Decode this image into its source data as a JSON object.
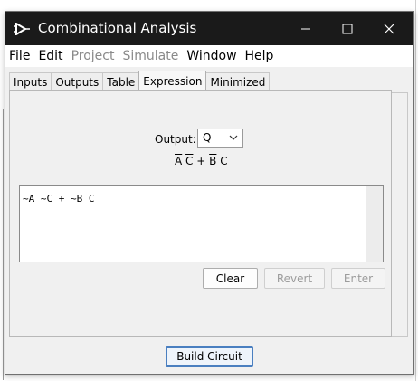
{
  "window": {
    "title": "Combinational Analysis"
  },
  "menu": [
    {
      "label": "File",
      "enabled": true
    },
    {
      "label": "Edit",
      "enabled": true
    },
    {
      "label": "Project",
      "enabled": false
    },
    {
      "label": "Simulate",
      "enabled": false
    },
    {
      "label": "Window",
      "enabled": true
    },
    {
      "label": "Help",
      "enabled": true
    }
  ],
  "tabs": [
    {
      "label": "Inputs",
      "selected": false
    },
    {
      "label": "Outputs",
      "selected": false
    },
    {
      "label": "Table",
      "selected": false
    },
    {
      "label": "Expression",
      "selected": true
    },
    {
      "label": "Minimized",
      "selected": false
    }
  ],
  "expression": {
    "output_label": "Output:",
    "output_value": "Q",
    "rendered": {
      "A": "A",
      "C1": "C",
      "plus": "+",
      "B": "B",
      "C2": "C"
    },
    "text": "~A ~C + ~B C",
    "buttons": {
      "clear": "Clear",
      "revert": "Revert",
      "enter": "Enter"
    }
  },
  "footer": {
    "build_circuit": "Build Circuit"
  },
  "icons": {
    "app": "logisim-gate-icon",
    "minimize": "minimize-icon",
    "maximize": "maximize-icon",
    "close": "close-icon",
    "dropdown": "chevron-down-icon"
  }
}
